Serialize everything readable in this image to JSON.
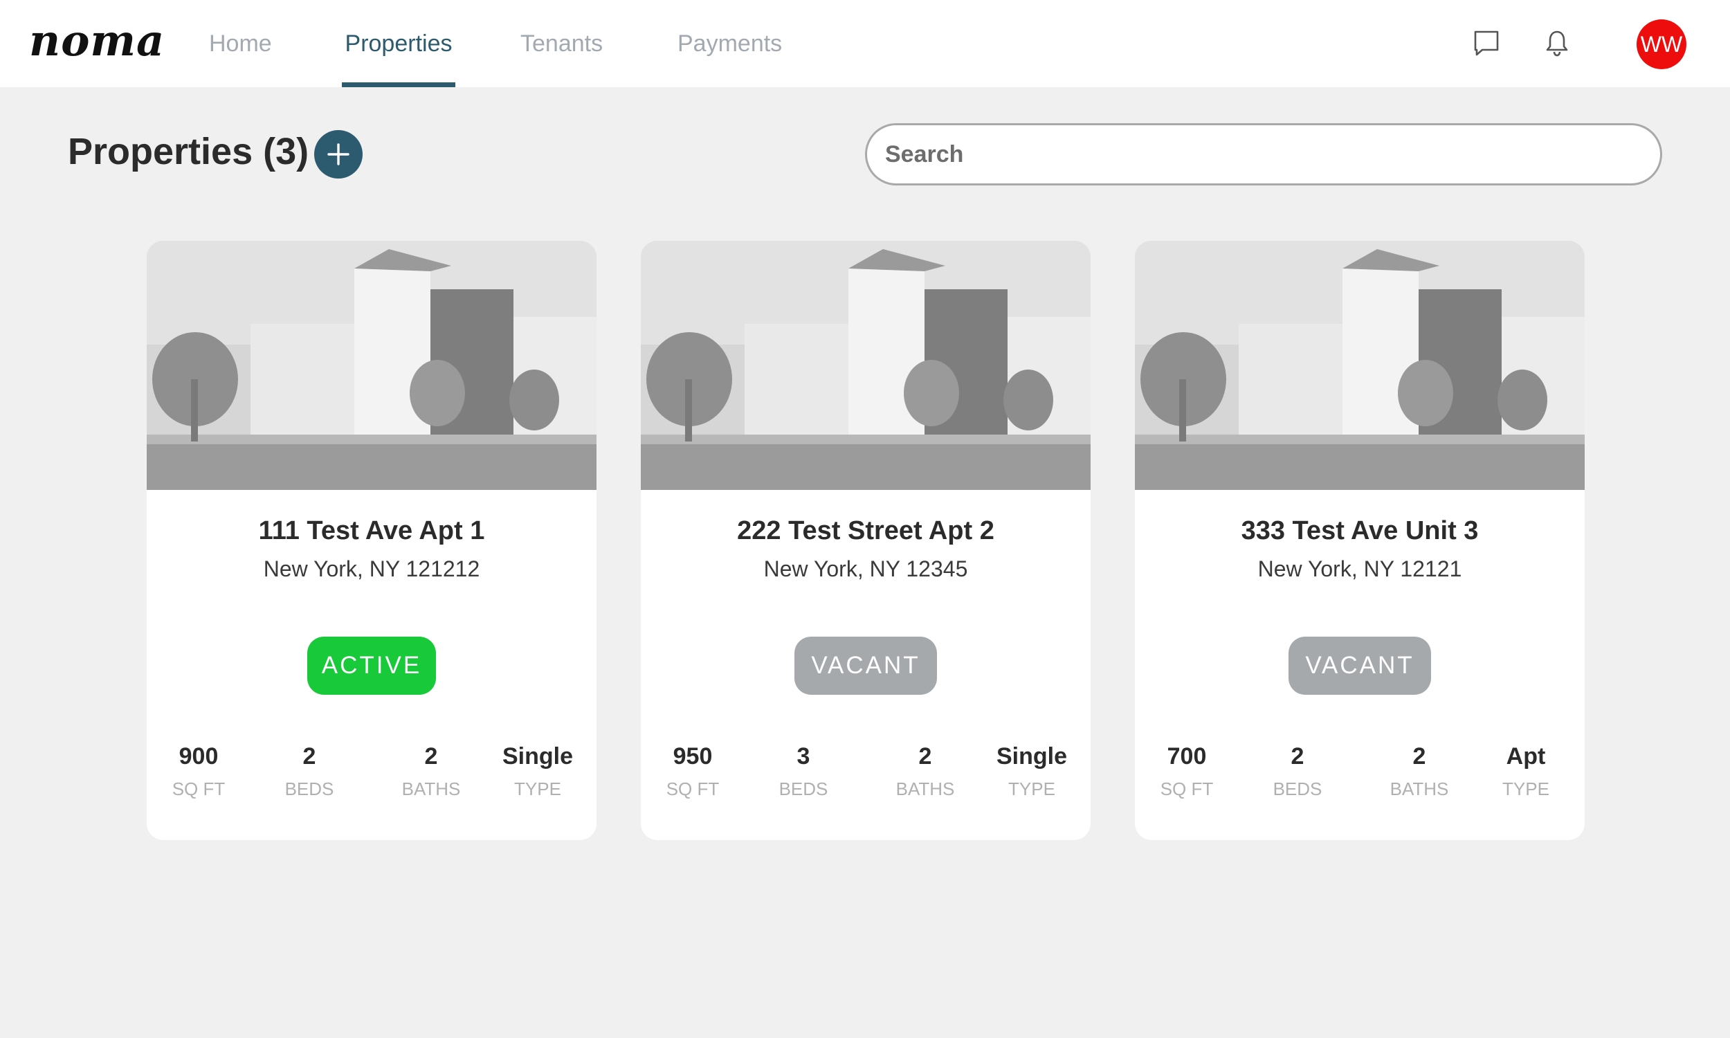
{
  "app": {
    "logo": "noma"
  },
  "nav": {
    "tabs": [
      {
        "label": "Home",
        "active": false
      },
      {
        "label": "Properties",
        "active": true
      },
      {
        "label": "Tenants",
        "active": false
      },
      {
        "label": "Payments",
        "active": false
      }
    ]
  },
  "header_icons": {
    "messages": "chat-icon",
    "notifications": "bell-icon"
  },
  "user": {
    "initials": "WW",
    "avatar_color": "#ee0d0d"
  },
  "page": {
    "title": "Properties (3)",
    "add_icon": "plus-icon"
  },
  "search": {
    "placeholder": "Search",
    "value": ""
  },
  "colors": {
    "accent": "#2c5a6e",
    "active": "#18c93a",
    "vacant": "#a6a9ac",
    "background": "#f0f0f0"
  },
  "properties": [
    {
      "title": "111 Test Ave Apt 1",
      "location": "New York, NY 121212",
      "status": "ACTIVE",
      "stats": [
        {
          "value": "900",
          "label": "SQ FT"
        },
        {
          "value": "2",
          "label": "BEDS"
        },
        {
          "value": "2",
          "label": "BATHS"
        },
        {
          "value": "Single",
          "label": "TYPE"
        }
      ]
    },
    {
      "title": "222 Test Street Apt 2",
      "location": "New York, NY 12345",
      "status": "VACANT",
      "stats": [
        {
          "value": "950",
          "label": "SQ FT"
        },
        {
          "value": "3",
          "label": "BEDS"
        },
        {
          "value": "2",
          "label": "BATHS"
        },
        {
          "value": "Single",
          "label": "TYPE"
        }
      ]
    },
    {
      "title": "333 Test Ave Unit 3",
      "location": "New York, NY 12121",
      "status": "VACANT",
      "stats": [
        {
          "value": "700",
          "label": "SQ FT"
        },
        {
          "value": "2",
          "label": "BEDS"
        },
        {
          "value": "2",
          "label": "BATHS"
        },
        {
          "value": "Apt",
          "label": "TYPE"
        }
      ]
    }
  ]
}
